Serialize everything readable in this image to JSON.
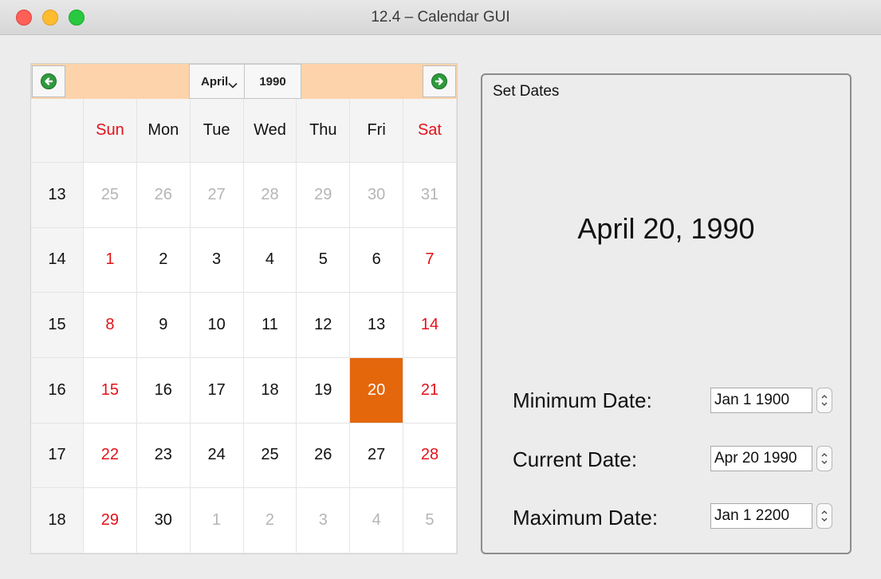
{
  "window": {
    "title": "12.4 – Calendar GUI"
  },
  "calendar": {
    "month": "April",
    "year": "1990",
    "day_headers": [
      "Sun",
      "Mon",
      "Tue",
      "Wed",
      "Thu",
      "Fri",
      "Sat"
    ],
    "weeks": [
      {
        "week": "13",
        "days": [
          "25",
          "26",
          "27",
          "28",
          "29",
          "30",
          "31"
        ]
      },
      {
        "week": "14",
        "days": [
          "1",
          "2",
          "3",
          "4",
          "5",
          "6",
          "7"
        ]
      },
      {
        "week": "15",
        "days": [
          "8",
          "9",
          "10",
          "11",
          "12",
          "13",
          "14"
        ]
      },
      {
        "week": "16",
        "days": [
          "15",
          "16",
          "17",
          "18",
          "19",
          "20",
          "21"
        ]
      },
      {
        "week": "17",
        "days": [
          "22",
          "23",
          "24",
          "25",
          "26",
          "27",
          "28"
        ]
      },
      {
        "week": "18",
        "days": [
          "29",
          "30",
          "1",
          "2",
          "3",
          "4",
          "5"
        ]
      }
    ],
    "selected_day": "20",
    "colors": {
      "nav_bar": "#fdd3ab",
      "selected": "#e4670c",
      "weekend": "#e3121a",
      "other_month": "#b5b5b5"
    },
    "icons": {
      "prev": "left-arrow-circle-icon",
      "next": "right-arrow-circle-icon"
    }
  },
  "set_dates": {
    "title": "Set Dates",
    "display_date": "April 20, 1990",
    "minimum": {
      "label": "Minimum Date:",
      "value": "Jan 1 1900"
    },
    "current": {
      "label": "Current Date:",
      "value": "Apr 20 1990"
    },
    "maximum": {
      "label": "Maximum Date:",
      "value": "Jan 1 2200"
    }
  }
}
